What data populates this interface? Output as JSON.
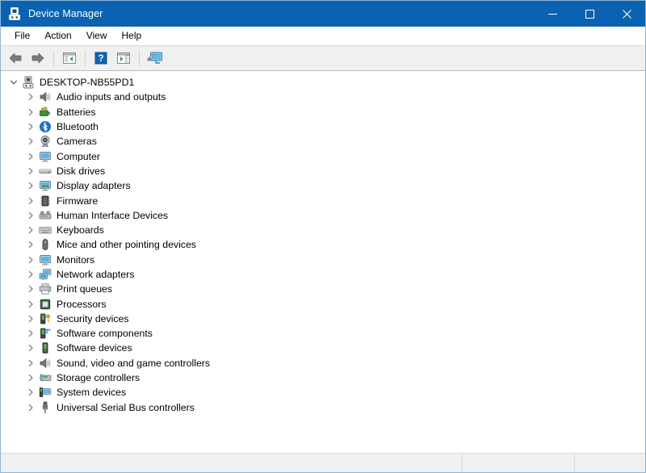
{
  "window": {
    "title": "Device Manager",
    "title_icon": "device-manager-icon",
    "accent_color": "#0a62b0",
    "border_color": "#8fb6d4"
  },
  "window_buttons": [
    {
      "name": "minimize",
      "glyph": "minimize-icon",
      "label": "Minimize"
    },
    {
      "name": "maximize",
      "glyph": "maximize-icon",
      "label": "Maximize"
    },
    {
      "name": "close",
      "glyph": "close-icon",
      "label": "Close"
    }
  ],
  "menubar": {
    "items": [
      {
        "label": "File"
      },
      {
        "label": "Action"
      },
      {
        "label": "View"
      },
      {
        "label": "Help"
      }
    ]
  },
  "toolbar": {
    "buttons": [
      {
        "name": "back-button",
        "icon": "back-arrow-icon"
      },
      {
        "name": "forward-button",
        "icon": "forward-arrow-icon"
      },
      {
        "name": "show-hide-console-tree-button",
        "icon": "console-tree-icon"
      },
      {
        "name": "help-button",
        "icon": "question-mark-icon"
      },
      {
        "name": "properties-button",
        "icon": "properties-panel-icon"
      },
      {
        "name": "scan-for-hardware-changes-button",
        "icon": "scan-hardware-icon"
      }
    ]
  },
  "tree": {
    "root": {
      "label": "DESKTOP-NB55PD1",
      "icon": "computer-root-icon",
      "expanded": true,
      "chevron": "chevron-down"
    },
    "items": [
      {
        "label": "Audio inputs and outputs",
        "icon": "speaker-icon"
      },
      {
        "label": "Batteries",
        "icon": "battery-icon"
      },
      {
        "label": "Bluetooth",
        "icon": "bluetooth-icon"
      },
      {
        "label": "Cameras",
        "icon": "camera-icon"
      },
      {
        "label": "Computer",
        "icon": "monitor-icon"
      },
      {
        "label": "Disk drives",
        "icon": "disk-drive-icon"
      },
      {
        "label": "Display adapters",
        "icon": "display-adapter-icon"
      },
      {
        "label": "Firmware",
        "icon": "firmware-chip-icon"
      },
      {
        "label": "Human Interface Devices",
        "icon": "hid-icon"
      },
      {
        "label": "Keyboards",
        "icon": "keyboard-icon"
      },
      {
        "label": "Mice and other pointing devices",
        "icon": "mouse-icon"
      },
      {
        "label": "Monitors",
        "icon": "monitor-icon"
      },
      {
        "label": "Network adapters",
        "icon": "network-adapter-icon"
      },
      {
        "label": "Print queues",
        "icon": "printer-icon"
      },
      {
        "label": "Processors",
        "icon": "processor-icon"
      },
      {
        "label": "Security devices",
        "icon": "security-key-icon"
      },
      {
        "label": "Software components",
        "icon": "software-component-icon"
      },
      {
        "label": "Software devices",
        "icon": "software-device-icon"
      },
      {
        "label": "Sound, video and game controllers",
        "icon": "speaker-icon"
      },
      {
        "label": "Storage controllers",
        "icon": "storage-controller-icon"
      },
      {
        "label": "System devices",
        "icon": "system-device-icon"
      },
      {
        "label": "Universal Serial Bus controllers",
        "icon": "usb-icon"
      }
    ],
    "collapsed_chevron": "chevron-right"
  },
  "statusbar": {
    "panels": [
      {
        "text": ""
      },
      {
        "text": ""
      },
      {
        "text": ""
      }
    ]
  }
}
